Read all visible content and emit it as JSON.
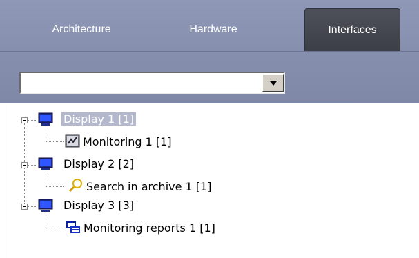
{
  "tabs": [
    {
      "label": "Architecture",
      "active": false
    },
    {
      "label": "Hardware",
      "active": false
    },
    {
      "label": "Interfaces",
      "active": true
    }
  ],
  "combo": {
    "value": ""
  },
  "tree": {
    "nodes": [
      {
        "label": "Display 1 [1]",
        "icon": "monitor-icon",
        "selected": true,
        "children": [
          {
            "label": "Monitoring 1 [1]",
            "icon": "monitoring-icon"
          }
        ]
      },
      {
        "label": "Display 2 [2]",
        "icon": "monitor-icon",
        "selected": false,
        "children": [
          {
            "label": "Search in archive 1 [1]",
            "icon": "search-archive-icon"
          }
        ]
      },
      {
        "label": "Display 3 [3]",
        "icon": "monitor-icon",
        "selected": false,
        "children": [
          {
            "label": "Monitoring reports 1 [1]",
            "icon": "monitoring-reports-icon"
          }
        ]
      }
    ]
  },
  "colors": {
    "tabbar": "#8a93b2",
    "active_tab": "#45474f",
    "selection": "#b4b8cc"
  }
}
